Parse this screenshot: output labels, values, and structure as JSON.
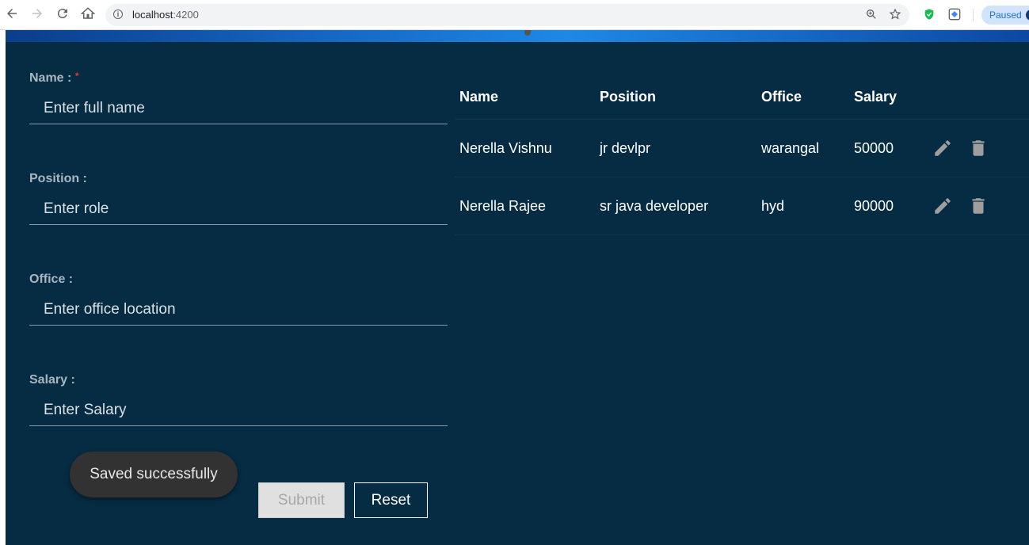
{
  "browser": {
    "url_host": "localhost",
    "url_port": ":4200",
    "profile_status": "Paused"
  },
  "form": {
    "name_label": "Name :",
    "name_required_marker": "*",
    "name_placeholder": "Enter full name",
    "position_label": "Position :",
    "position_placeholder": "Enter role",
    "office_label": "Office :",
    "office_placeholder": "Enter office location",
    "salary_label": "Salary :",
    "salary_placeholder": "Enter Salary",
    "submit_label": "Submit",
    "reset_label": "Reset"
  },
  "toast": {
    "message": "Saved successfully"
  },
  "table": {
    "headers": [
      "Name",
      "Position",
      "Office",
      "Salary"
    ],
    "rows": [
      {
        "name": "Nerella Vishnu",
        "position": "jr devlpr",
        "office": "warangal",
        "salary": "50000"
      },
      {
        "name": "Nerella Rajee",
        "position": "sr java developer",
        "office": "hyd",
        "salary": "90000"
      }
    ]
  },
  "colors": {
    "page_background": "#062c43",
    "banner_accent": "#1e88e5",
    "required": "#e53935",
    "toast_background": "#323232",
    "icon_gray": "#9e9e9e"
  },
  "icons": [
    "back-arrow-icon",
    "forward-arrow-icon",
    "reload-icon",
    "home-icon",
    "info-icon",
    "zoom-icon",
    "star-icon",
    "shield-extension-icon",
    "extension-icon",
    "edit-pencil-icon",
    "delete-trash-icon"
  ]
}
